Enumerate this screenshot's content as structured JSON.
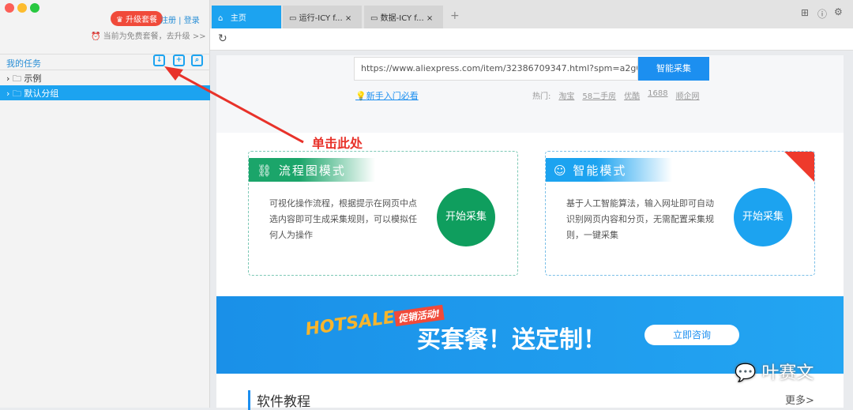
{
  "sidebar": {
    "upgrade": "升级套餐",
    "register_login": "注册 | 登录",
    "free_notice": "当前为免费套餐，去升级 >>",
    "my_tasks": "我的任务",
    "folders": [
      {
        "label": "示例"
      },
      {
        "label": "默认分组"
      }
    ]
  },
  "tabs": [
    {
      "label": "主页"
    },
    {
      "label": "运行-ICY f..."
    },
    {
      "label": "数据-ICY f..."
    }
  ],
  "home": {
    "url": "https://www.aliexpress.com/item/32386709347.html?spm=a2g0",
    "smart_btn": "智能采集",
    "guide": "新手入门必看",
    "hot_label": "热门:",
    "hot": [
      "淘宝",
      "58二手房",
      "优酷",
      "1688",
      "顺企网"
    ],
    "cards": [
      {
        "title": "流程图模式",
        "desc": "可视化操作流程，根据提示在网页中点选内容即可生成采集规则，可以模拟任何人为操作",
        "button": "开始采集"
      },
      {
        "title": "智能模式",
        "desc": "基于人工智能算法，输入网址即可自动识别网页内容和分页，无需配置采集规则，一键采集",
        "button": "开始采集"
      }
    ],
    "banner": {
      "hot": "HOTSALE",
      "promo": "促销活动!",
      "slogan": "买套餐！送定制！",
      "consult": "立即咨询"
    },
    "tutorial": "软件教程",
    "more": "更多>"
  },
  "annotation": "单击此处",
  "watermark": "叶赛文"
}
